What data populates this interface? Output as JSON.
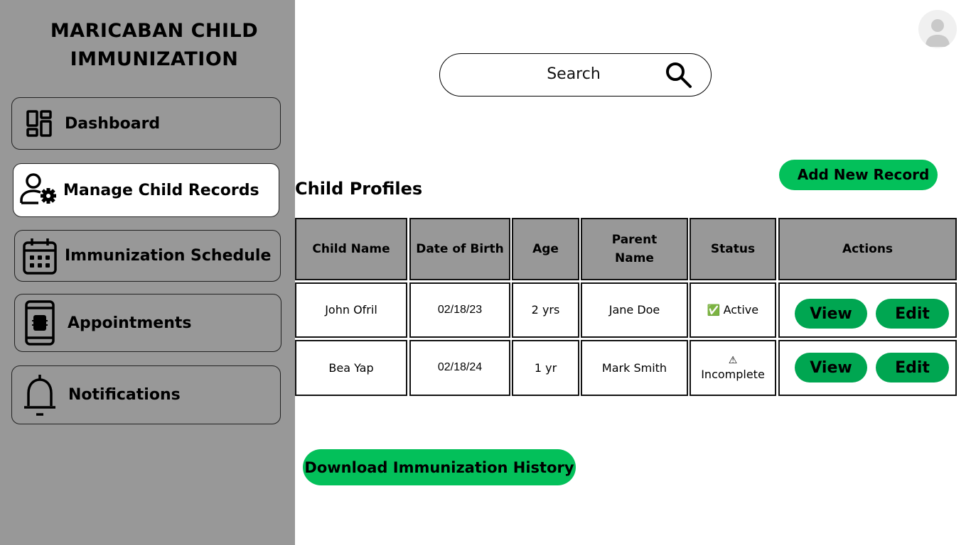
{
  "app": {
    "title": "MARICABAN CHILD IMMUNIZATION"
  },
  "sidebar": {
    "items": [
      {
        "label": "Dashboard",
        "icon": "dashboard-icon",
        "active": false
      },
      {
        "label": "Manage Child Records",
        "icon": "user-settings-icon",
        "active": true
      },
      {
        "label": "Immunization Schedule",
        "icon": "calendar-icon",
        "active": false
      },
      {
        "label": "Appointments",
        "icon": "phone-icon",
        "active": false
      },
      {
        "label": "Notifications",
        "icon": "bell-icon",
        "active": false
      }
    ]
  },
  "search": {
    "placeholder": "Search"
  },
  "section": {
    "title": "Child Profiles",
    "add_label": "Add New Record"
  },
  "table": {
    "headers": [
      "Child Name",
      "Date of Birth",
      "Age",
      "Parent Name",
      "Status",
      "Actions"
    ],
    "rows": [
      {
        "child_name": "John Ofril",
        "dob": "02/18/23",
        "age": "2 yrs",
        "parent": "Jane Doe",
        "status_icon": "✅",
        "status": "Active"
      },
      {
        "child_name": "Bea Yap",
        "dob": "02/18/24",
        "age": "1 yr",
        "parent": "Mark Smith",
        "status_icon": "⚠",
        "status": "Incomplete"
      }
    ],
    "actions": {
      "view_label": "View",
      "edit_label": "Edit"
    }
  },
  "download": {
    "label": "Download Immunization History"
  },
  "colors": {
    "sidebar": "#989898",
    "accent_green": "#03c05a",
    "action_green": "#00a651"
  }
}
